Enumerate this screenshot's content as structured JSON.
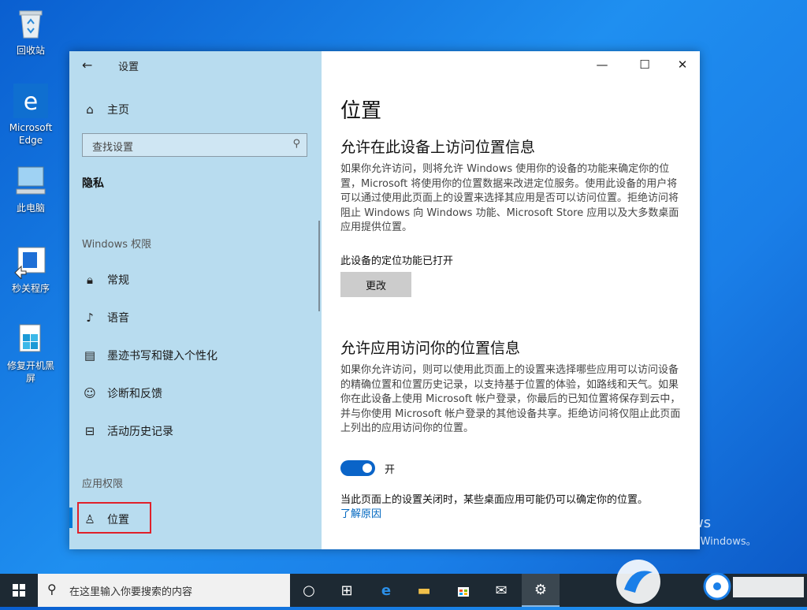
{
  "desktop": {
    "icons": [
      {
        "label": "回收站"
      },
      {
        "label": "Microsoft Edge"
      },
      {
        "label": "此电脑"
      },
      {
        "label": "秒关程序"
      },
      {
        "label": "修复开机黑屏"
      }
    ]
  },
  "window": {
    "title": "设置",
    "controls": {
      "minimize": "—",
      "maximize": "☐",
      "close": "✕"
    }
  },
  "sidebar": {
    "home": "主页",
    "search_placeholder": "查找设置",
    "category": "隐私",
    "windows_perms_header": "Windows 权限",
    "windows_items": [
      {
        "label": "常规",
        "icon": "lock-icon"
      },
      {
        "label": "语音",
        "icon": "speech-icon"
      },
      {
        "label": "墨迹书写和键入个性化",
        "icon": "ink-icon"
      },
      {
        "label": "诊断和反馈",
        "icon": "feedback-icon"
      },
      {
        "label": "活动历史记录",
        "icon": "history-icon"
      }
    ],
    "app_perms_header": "应用权限",
    "active_item": {
      "label": "位置",
      "icon": "location-icon"
    }
  },
  "content": {
    "page_title": "位置",
    "section1_title": "允许在此设备上访问位置信息",
    "section1_desc": "如果你允许访问，则将允许 Windows 使用你的设备的功能来确定你的位置，Microsoft 将使用你的位置数据来改进定位服务。使用此设备的用户将可以通过使用此页面上的设置来选择其应用是否可以访问位置。拒绝访问将阻止 Windows 向 Windows 功能、Microsoft Store 应用以及大多数桌面应用提供位置。",
    "device_status": "此设备的定位功能已打开",
    "change_button": "更改",
    "section2_title": "允许应用访问你的位置信息",
    "section2_desc": "如果你允许访问，则可以使用此页面上的设置来选择哪些应用可以访问设备的精确位置和位置历史记录，以支持基于位置的体验，如路线和天气。如果你在此设备上使用 Microsoft 帐户登录，你最后的已知位置将保存到云中，并与你使用 Microsoft 帐户登录的其他设备共享。拒绝访问将仅阻止此页面上列出的应用访问你的位置。",
    "toggle_label": "开",
    "toggle_on": true,
    "note": "当此页面上的设置关闭时，某些桌面应用可能仍可以确定你的位置。",
    "learn_more": "了解原因"
  },
  "activation": {
    "line1": "激活 Windows",
    "line2": "转到“设置”以激活 Windows。"
  },
  "taskbar": {
    "search_placeholder": "在这里输入你要搜索的内容"
  },
  "colors": {
    "accent": "#0078d7",
    "sidebar_bg": "#b8dcef",
    "taskbar_bg": "#1d2933",
    "highlight_box": "#e0202a"
  }
}
